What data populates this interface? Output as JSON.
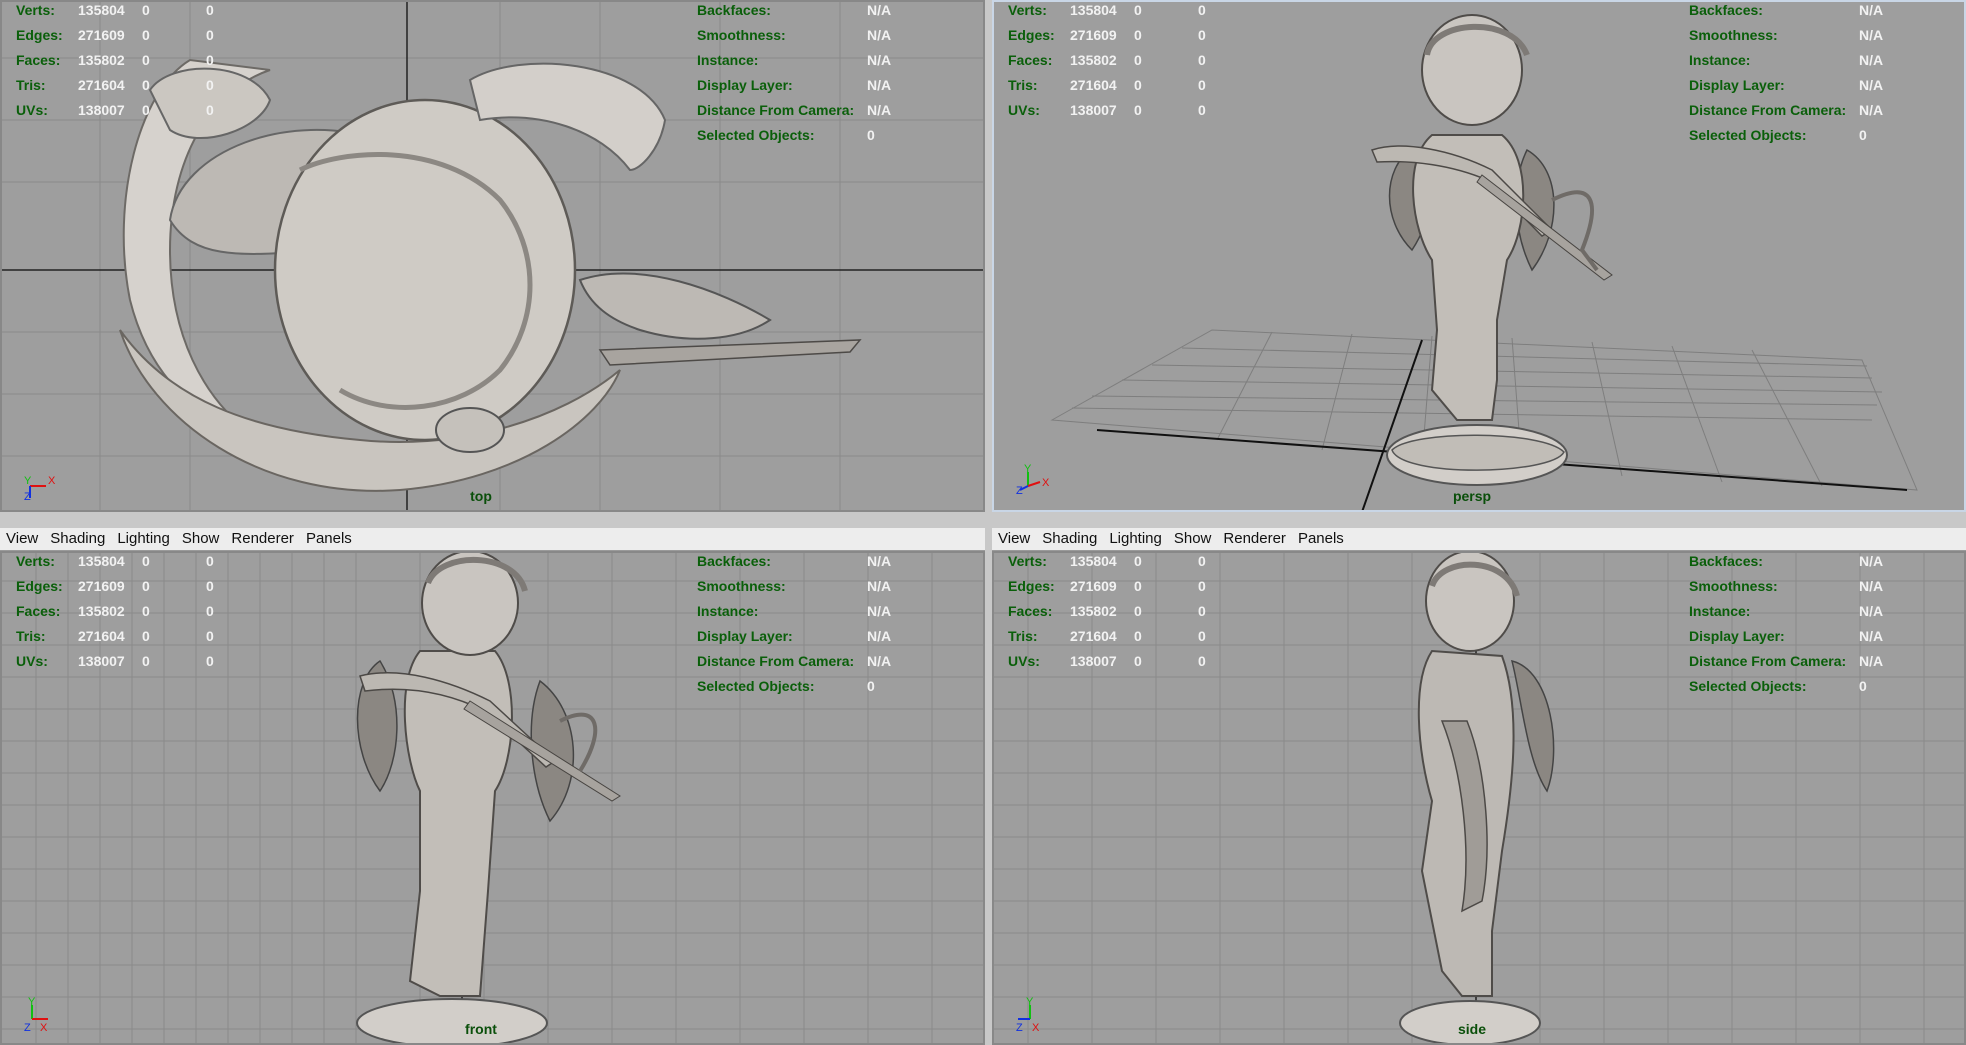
{
  "menu": [
    "View",
    "Shading",
    "Lighting",
    "Show",
    "Renderer",
    "Panels"
  ],
  "stats_left": [
    {
      "label": "Verts:",
      "v1": "135804",
      "v2": "0",
      "v3": "0"
    },
    {
      "label": "Edges:",
      "v1": "271609",
      "v2": "0",
      "v3": "0"
    },
    {
      "label": "Faces:",
      "v1": "135802",
      "v2": "0",
      "v3": "0"
    },
    {
      "label": "Tris:",
      "v1": "271604",
      "v2": "0",
      "v3": "0"
    },
    {
      "label": "UVs:",
      "v1": "138007",
      "v2": "0",
      "v3": "0"
    }
  ],
  "stats_right": [
    {
      "label": "Backfaces:",
      "value": "N/A"
    },
    {
      "label": "Smoothness:",
      "value": "N/A"
    },
    {
      "label": "Instance:",
      "value": "N/A"
    },
    {
      "label": "Display Layer:",
      "value": "N/A"
    },
    {
      "label": "Distance From Camera:",
      "value": "N/A"
    },
    {
      "label": "Selected Objects:",
      "value": "0"
    }
  ],
  "views": {
    "top": {
      "camera": "top",
      "axes": [
        "Y",
        "X",
        "Z"
      ]
    },
    "persp": {
      "camera": "persp",
      "axes": [
        "Y",
        "Z",
        "X"
      ]
    },
    "front": {
      "camera": "front",
      "axes": [
        "Y",
        "Z",
        "X"
      ]
    },
    "side": {
      "camera": "side",
      "axes": [
        "Y",
        "Z",
        "X"
      ]
    }
  },
  "colors": {
    "viewport_bg": "#9e9e9e",
    "hud_label": "#0a5f0a",
    "hud_value": "#f2f2f2",
    "axis_x": "#e01010",
    "axis_y": "#10c010",
    "axis_z": "#1030e0"
  }
}
